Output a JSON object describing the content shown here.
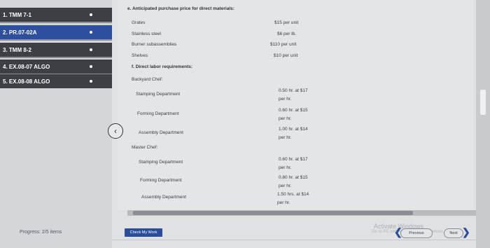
{
  "sidebar": {
    "items": [
      {
        "label": "1. TMM 7-1"
      },
      {
        "label": "2. PR.07-02A"
      },
      {
        "label": "3. TMM 8-2"
      },
      {
        "label": "4. EX.08-07 ALGO"
      },
      {
        "label": "5. EX.08-08 ALGO"
      }
    ],
    "progress": "Progress: 2/5 items"
  },
  "content": {
    "heading_e": "e. Anticipated purchase price for direct materials:",
    "materials": [
      {
        "name": "Grates",
        "price": "$15 per unit"
      },
      {
        "name": "Stainless steel",
        "price": "$6 per lb."
      },
      {
        "name": "Burner subassemblies",
        "price": "$110 per unit"
      },
      {
        "name": "Shelves",
        "price": "$10 per unit"
      }
    ],
    "heading_f": "f. Direct labor requirements:",
    "backyard_label": "Backyard Chef:",
    "backyard": [
      {
        "dept": "Stamping Department",
        "line1": "0.50 hr. at $17",
        "line2": "per hr."
      },
      {
        "dept": "Forming Department",
        "line1": "0.60 hr. at $15",
        "line2": "per hr."
      },
      {
        "dept": "Assembly Department",
        "line1": "1.00 hr. at $14",
        "line2": "per hr."
      }
    ],
    "master_label": "Master Chef:",
    "master": [
      {
        "dept": "Stamping Department",
        "line1": "0.60 hr. at $17",
        "line2": "per hr."
      },
      {
        "dept": "Forming Department",
        "line1": "0.80 hr. at $15",
        "line2": "per hr."
      },
      {
        "dept": "Assembly Department",
        "line1": "1.50 hrs. at $14",
        "line2": "per hr."
      }
    ]
  },
  "footer": {
    "check_button": "Check My Work",
    "watermark_title": "Activate Windows",
    "watermark_sub": "Go to PC settings to activate Windows.",
    "previous": "Previous",
    "next": "Next"
  },
  "icons": {
    "back": "chevron-left-icon",
    "previous": "chevron-left-icon",
    "next": "chevron-right-icon"
  }
}
